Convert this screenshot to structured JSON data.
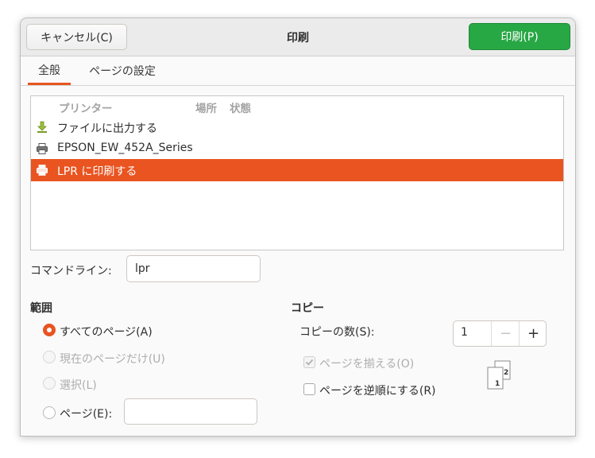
{
  "header": {
    "title": "印刷",
    "cancel_label": "キャンセル(C)",
    "print_label": "印刷(P)"
  },
  "tabs": [
    {
      "label": "全般",
      "active": true
    },
    {
      "label": "ページの設定",
      "active": false
    }
  ],
  "printers": {
    "columns": [
      "プリンター",
      "場所",
      "状態"
    ],
    "items": [
      {
        "name": "ファイルに出力する",
        "icon": "file-download-icon",
        "selected": false
      },
      {
        "name": "EPSON_EW_452A_Series",
        "icon": "printer-icon",
        "selected": false
      },
      {
        "name": "LPR に印刷する",
        "icon": "printer-icon",
        "selected": true
      }
    ]
  },
  "command_line": {
    "label": "コマンドライン:",
    "value": "lpr"
  },
  "range": {
    "title": "範囲",
    "options": [
      {
        "label": "すべてのページ(A)",
        "checked": true,
        "enabled": true
      },
      {
        "label": "現在のページだけ(U)",
        "checked": false,
        "enabled": false
      },
      {
        "label": "選択(L)",
        "checked": false,
        "enabled": false
      },
      {
        "label": "ページ(E):",
        "checked": false,
        "enabled": true
      }
    ],
    "pages_value": ""
  },
  "copies": {
    "title": "コピー",
    "count_label": "コピーの数(S):",
    "count_value": "1",
    "collate_label": "ページを揃える(O)",
    "collate_checked": true,
    "collate_enabled": false,
    "reverse_label": "ページを逆順にする(R)",
    "reverse_checked": false,
    "collate_preview": [
      "1",
      "2"
    ]
  },
  "colors": {
    "accent": "#e95420",
    "print_button": "#28a745"
  }
}
